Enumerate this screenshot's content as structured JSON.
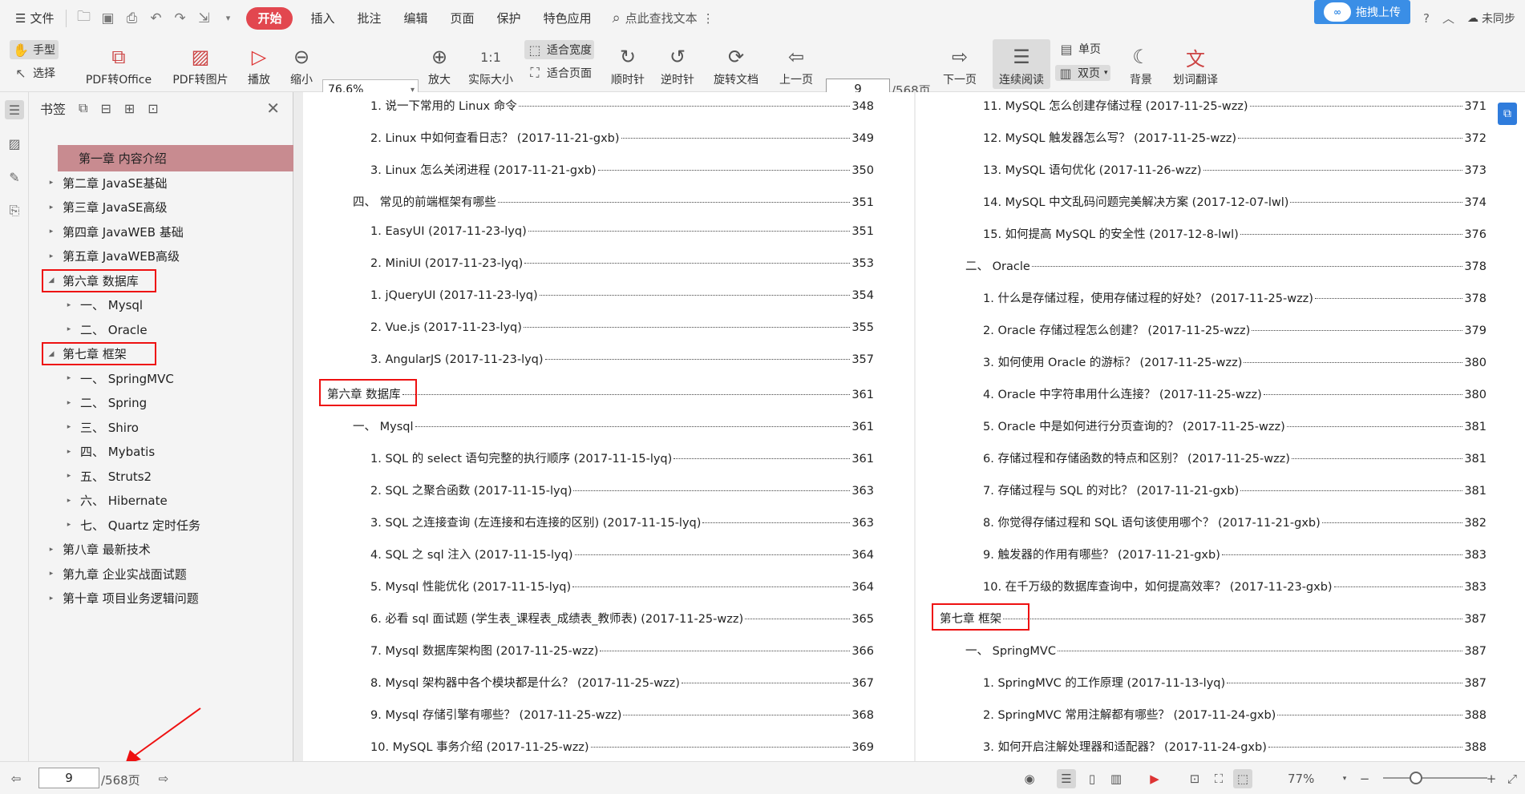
{
  "menubar": {
    "file_label": "文件",
    "tabs": [
      "开始",
      "插入",
      "批注",
      "编辑",
      "页面",
      "保护",
      "特色应用"
    ],
    "active_tab": "开始",
    "search_label": "点此查找文本",
    "upload_label": "拖拽上传",
    "login_label": "未同步"
  },
  "toolbar": {
    "hand": "手型",
    "select": "选择",
    "pdf_to_office": "PDF转Office",
    "pdf_to_image": "PDF转图片",
    "play": "播放",
    "zoom_out": "缩小",
    "zoom_value": "76.6%",
    "zoom_in": "放大",
    "actual_size": "实际大小",
    "fit_width": "适合宽度",
    "fit_page": "适合页面",
    "rotate_cw": "顺时针",
    "rotate_ccw": "逆时针",
    "rotate_doc": "旋转文档",
    "prev_page": "上一页",
    "page_value": "9",
    "page_total": "/568页",
    "next_page": "下一页",
    "continuous": "连续阅读",
    "single": "单页",
    "double": "双页",
    "background": "背景",
    "translate": "划词翻译"
  },
  "bookmarks": {
    "title": "书签",
    "items": [
      {
        "label": "第一章  内容介绍",
        "level": 0,
        "arrow": "",
        "selected": true
      },
      {
        "label": "第二章  JavaSE基础",
        "level": 0,
        "arrow": "▸"
      },
      {
        "label": "第三章  JavaSE高级",
        "level": 0,
        "arrow": "▸"
      },
      {
        "label": "第四章  JavaWEB 基础",
        "level": 0,
        "arrow": "▸"
      },
      {
        "label": "第五章  JavaWEB高级",
        "level": 0,
        "arrow": "▸"
      },
      {
        "label": "第六章  数据库",
        "level": 0,
        "arrow": "◢",
        "boxed": true
      },
      {
        "label": "一、  Mysql",
        "level": 1,
        "arrow": "▸"
      },
      {
        "label": "二、  Oracle",
        "level": 1,
        "arrow": "▸"
      },
      {
        "label": "第七章  框架",
        "level": 0,
        "arrow": "◢",
        "boxed": true
      },
      {
        "label": "一、  SpringMVC",
        "level": 1,
        "arrow": "▸"
      },
      {
        "label": "二、  Spring",
        "level": 1,
        "arrow": "▸"
      },
      {
        "label": "三、  Shiro",
        "level": 1,
        "arrow": "▸"
      },
      {
        "label": "四、  Mybatis",
        "level": 1,
        "arrow": "▸"
      },
      {
        "label": "五、  Struts2",
        "level": 1,
        "arrow": "▸"
      },
      {
        "label": "六、  Hibernate",
        "level": 1,
        "arrow": "▸"
      },
      {
        "label": "七、  Quartz 定时任务",
        "level": 1,
        "arrow": "▸"
      },
      {
        "label": "第八章  最新技术",
        "level": 0,
        "arrow": "▸"
      },
      {
        "label": "第九章  企业实战面试题",
        "level": 0,
        "arrow": "▸"
      },
      {
        "label": "第十章  项目业务逻辑问题",
        "level": 0,
        "arrow": "▸"
      }
    ]
  },
  "left_page": [
    {
      "label": "1. 说一下常用的 Linux 命令",
      "page": "348",
      "indent": 2
    },
    {
      "label": "2. Linux 中如何查看日志？ (2017-11-21-gxb)",
      "page": "349",
      "indent": 2
    },
    {
      "label": "3. Linux 怎么关闭进程 (2017-11-21-gxb)",
      "page": "350",
      "indent": 2
    },
    {
      "label": "四、  常见的前端框架有哪些",
      "page": "351",
      "indent": 1
    },
    {
      "label": "1. EasyUI (2017-11-23-lyq)",
      "page": "351",
      "indent": 2
    },
    {
      "label": "2. MiniUI (2017-11-23-lyq)",
      "page": "353",
      "indent": 2
    },
    {
      "label": "1. jQueryUI (2017-11-23-lyq)",
      "page": "354",
      "indent": 2
    },
    {
      "label": "2. Vue.js (2017-11-23-lyq)",
      "page": "355",
      "indent": 2
    },
    {
      "label": "3. AngularJS   (2017-11-23-lyq)",
      "page": "357",
      "indent": 2
    },
    {
      "label": "第六章  数据库",
      "page": "361",
      "indent": 0,
      "boxed": true
    },
    {
      "label": "一、  Mysql",
      "page": "361",
      "indent": 1
    },
    {
      "label": "1. SQL 的 select 语句完整的执行顺序 (2017-11-15-lyq)",
      "page": "361",
      "indent": 2
    },
    {
      "label": "2. SQL 之聚合函数 (2017-11-15-lyq)",
      "page": "363",
      "indent": 2
    },
    {
      "label": "3. SQL 之连接查询 (左连接和右连接的区别)  (2017-11-15-lyq)",
      "page": "363",
      "indent": 2
    },
    {
      "label": "4. SQL 之 sql 注入 (2017-11-15-lyq)",
      "page": "364",
      "indent": 2
    },
    {
      "label": "5. Mysql 性能优化 (2017-11-15-lyq)",
      "page": "364",
      "indent": 2
    },
    {
      "label": "6. 必看 sql 面试题 (学生表_课程表_成绩表_教师表)  (2017-11-25-wzz)",
      "page": "365",
      "indent": 2
    },
    {
      "label": "7. Mysql 数据库架构图 (2017-11-25-wzz)",
      "page": "366",
      "indent": 2
    },
    {
      "label": "8. Mysql 架构器中各个模块都是什么？ (2017-11-25-wzz)",
      "page": "367",
      "indent": 2
    },
    {
      "label": "9. Mysql 存储引擎有哪些？ (2017-11-25-wzz)",
      "page": "368",
      "indent": 2
    },
    {
      "label": "10. MySQL 事务介绍 (2017-11-25-wzz)",
      "page": "369",
      "indent": 2
    }
  ],
  "right_page": [
    {
      "label": "11. MySQL 怎么创建存储过程 (2017-11-25-wzz)",
      "page": "371",
      "indent": 2
    },
    {
      "label": "12. MySQL 触发器怎么写？ (2017-11-25-wzz)",
      "page": "372",
      "indent": 2
    },
    {
      "label": "13. MySQL 语句优化 (2017-11-26-wzz)",
      "page": "373",
      "indent": 2
    },
    {
      "label": "14. MySQL 中文乱码问题完美解决方案 (2017-12-07-lwl)",
      "page": "374",
      "indent": 2
    },
    {
      "label": "15. 如何提高 MySQL 的安全性 (2017-12-8-lwl)",
      "page": "376",
      "indent": 2
    },
    {
      "label": "二、  Oracle",
      "page": "378",
      "indent": 1
    },
    {
      "label": "1. 什么是存储过程，使用存储过程的好处？ (2017-11-25-wzz)",
      "page": "378",
      "indent": 2
    },
    {
      "label": "2. Oracle 存储过程怎么创建？ (2017-11-25-wzz)",
      "page": "379",
      "indent": 2
    },
    {
      "label": "3. 如何使用 Oracle 的游标？ (2017-11-25-wzz)",
      "page": "380",
      "indent": 2
    },
    {
      "label": "4. Oracle 中字符串用什么连接？ (2017-11-25-wzz)",
      "page": "380",
      "indent": 2
    },
    {
      "label": "5. Oracle 中是如何进行分页查询的？ (2017-11-25-wzz)",
      "page": "381",
      "indent": 2
    },
    {
      "label": "6. 存储过程和存储函数的特点和区别？ (2017-11-25-wzz)",
      "page": "381",
      "indent": 2
    },
    {
      "label": "7. 存储过程与 SQL 的对比？ (2017-11-21-gxb)",
      "page": "381",
      "indent": 2
    },
    {
      "label": "8. 你觉得存储过程和 SQL 语句该使用哪个？ (2017-11-21-gxb)",
      "page": "382",
      "indent": 2
    },
    {
      "label": "9. 触发器的作用有哪些？ (2017-11-21-gxb)",
      "page": "383",
      "indent": 2
    },
    {
      "label": "10. 在千万级的数据库查询中，如何提高效率？ (2017-11-23-gxb)",
      "page": "383",
      "indent": 2
    },
    {
      "label": "第七章  框架",
      "page": "387",
      "indent": 0,
      "boxed": true
    },
    {
      "label": "一、  SpringMVC",
      "page": "387",
      "indent": 1
    },
    {
      "label": "1. SpringMVC 的工作原理 (2017-11-13-lyq)",
      "page": "387",
      "indent": 2
    },
    {
      "label": "2. SpringMVC 常用注解都有哪些？ (2017-11-24-gxb)",
      "page": "388",
      "indent": 2
    },
    {
      "label": "3. 如何开启注解处理器和适配器？ (2017-11-24-gxb)",
      "page": "388",
      "indent": 2
    }
  ],
  "statusbar": {
    "page_value": "9",
    "page_total": "/568页",
    "zoom": "77%"
  },
  "colors": {
    "accent": "#e2474f",
    "selected_bookmark": "#c88b90",
    "annotation_box": "#e11111",
    "upload": "#3a8ee6"
  }
}
